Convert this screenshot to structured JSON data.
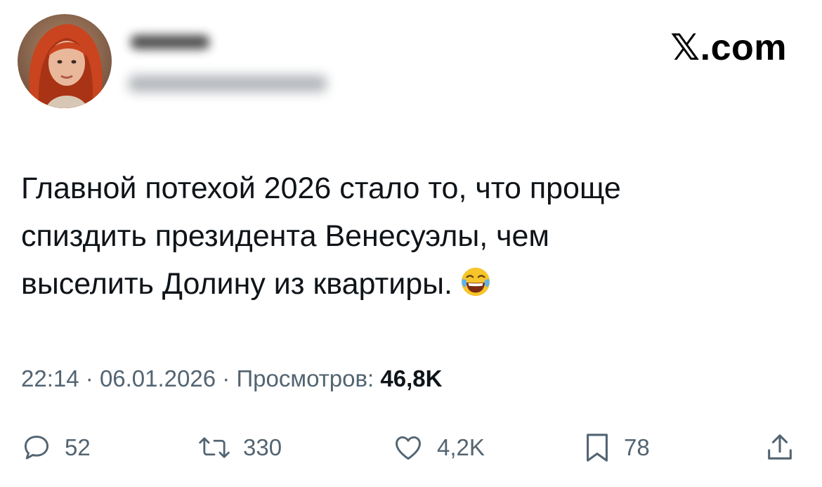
{
  "header": {
    "brand_text": ".com",
    "brand_glyph": "𝕏",
    "avatar_icon": "profile-photo"
  },
  "tweet": {
    "lines": [
      "Главной потехой 2026 стало то, что проще",
      "спиздить президента Венесуэлы, чем",
      "выселить Долину из квартиры."
    ],
    "emoji": "face-with-tears-of-joy-icon"
  },
  "meta": {
    "time": "22:14",
    "separator": "·",
    "date": "06.01.2026",
    "views_label": "Просмотров:",
    "views_value": "46,8K"
  },
  "actions": {
    "replies": "52",
    "reposts": "330",
    "likes": "4,2K",
    "bookmarks": "78"
  },
  "colors": {
    "text": "#0f1419",
    "secondary": "#536471",
    "background": "#ffffff"
  }
}
